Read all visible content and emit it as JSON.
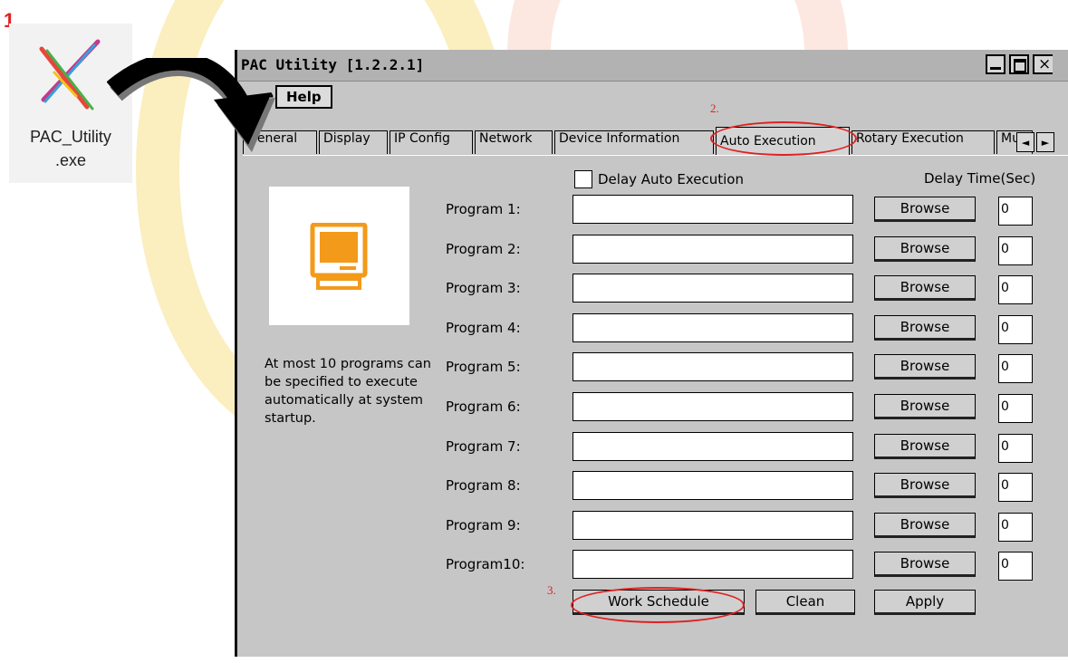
{
  "steps": {
    "step1": "1.",
    "step2": "2.",
    "step3": "3."
  },
  "exe": {
    "label_line1": "PAC_Utility",
    "label_line2": ".exe",
    "icon": "pac-utility-icon"
  },
  "window": {
    "title": "PAC Utility  [1.2.2.1]",
    "controls": {
      "minimize": "_",
      "maximize": "□",
      "close": "×"
    }
  },
  "menu": {
    "file": "e",
    "help": "Help"
  },
  "tabs": [
    {
      "label": "General"
    },
    {
      "label": "Display"
    },
    {
      "label": "IP Config"
    },
    {
      "label": "Network"
    },
    {
      "label": "Device Information"
    },
    {
      "label": "Auto Execution",
      "active": true
    },
    {
      "label": "Rotary Execution"
    },
    {
      "label": "Mu"
    }
  ],
  "tab_scroll": {
    "left": "◄",
    "right": "►"
  },
  "panel": {
    "help_text": "At most 10 programs can be specified to execute automatically at system startup.",
    "delay_auto_label": "Delay Auto Execution",
    "delay_time_label": "Delay Time(Sec)",
    "browse_label": "Browse",
    "programs": [
      {
        "label": "Program 1:",
        "value": "",
        "delay": "0"
      },
      {
        "label": "Program 2:",
        "value": "",
        "delay": "0"
      },
      {
        "label": "Program 3:",
        "value": "",
        "delay": "0"
      },
      {
        "label": "Program 4:",
        "value": "",
        "delay": "0"
      },
      {
        "label": "Program 5:",
        "value": "",
        "delay": "0"
      },
      {
        "label": "Program 6:",
        "value": "",
        "delay": "0"
      },
      {
        "label": "Program 7:",
        "value": "",
        "delay": "0"
      },
      {
        "label": "Program 8:",
        "value": "",
        "delay": "0"
      },
      {
        "label": "Program 9:",
        "value": "",
        "delay": "0"
      },
      {
        "label": "Program10:",
        "value": "",
        "delay": "0"
      }
    ],
    "buttons": {
      "work_schedule": "Work Schedule",
      "clean": "Clean",
      "apply": "Apply"
    }
  },
  "colors": {
    "annotation": "#e02020",
    "accent_orange": "#f39a1a",
    "window_bg": "#c6c6c6"
  }
}
